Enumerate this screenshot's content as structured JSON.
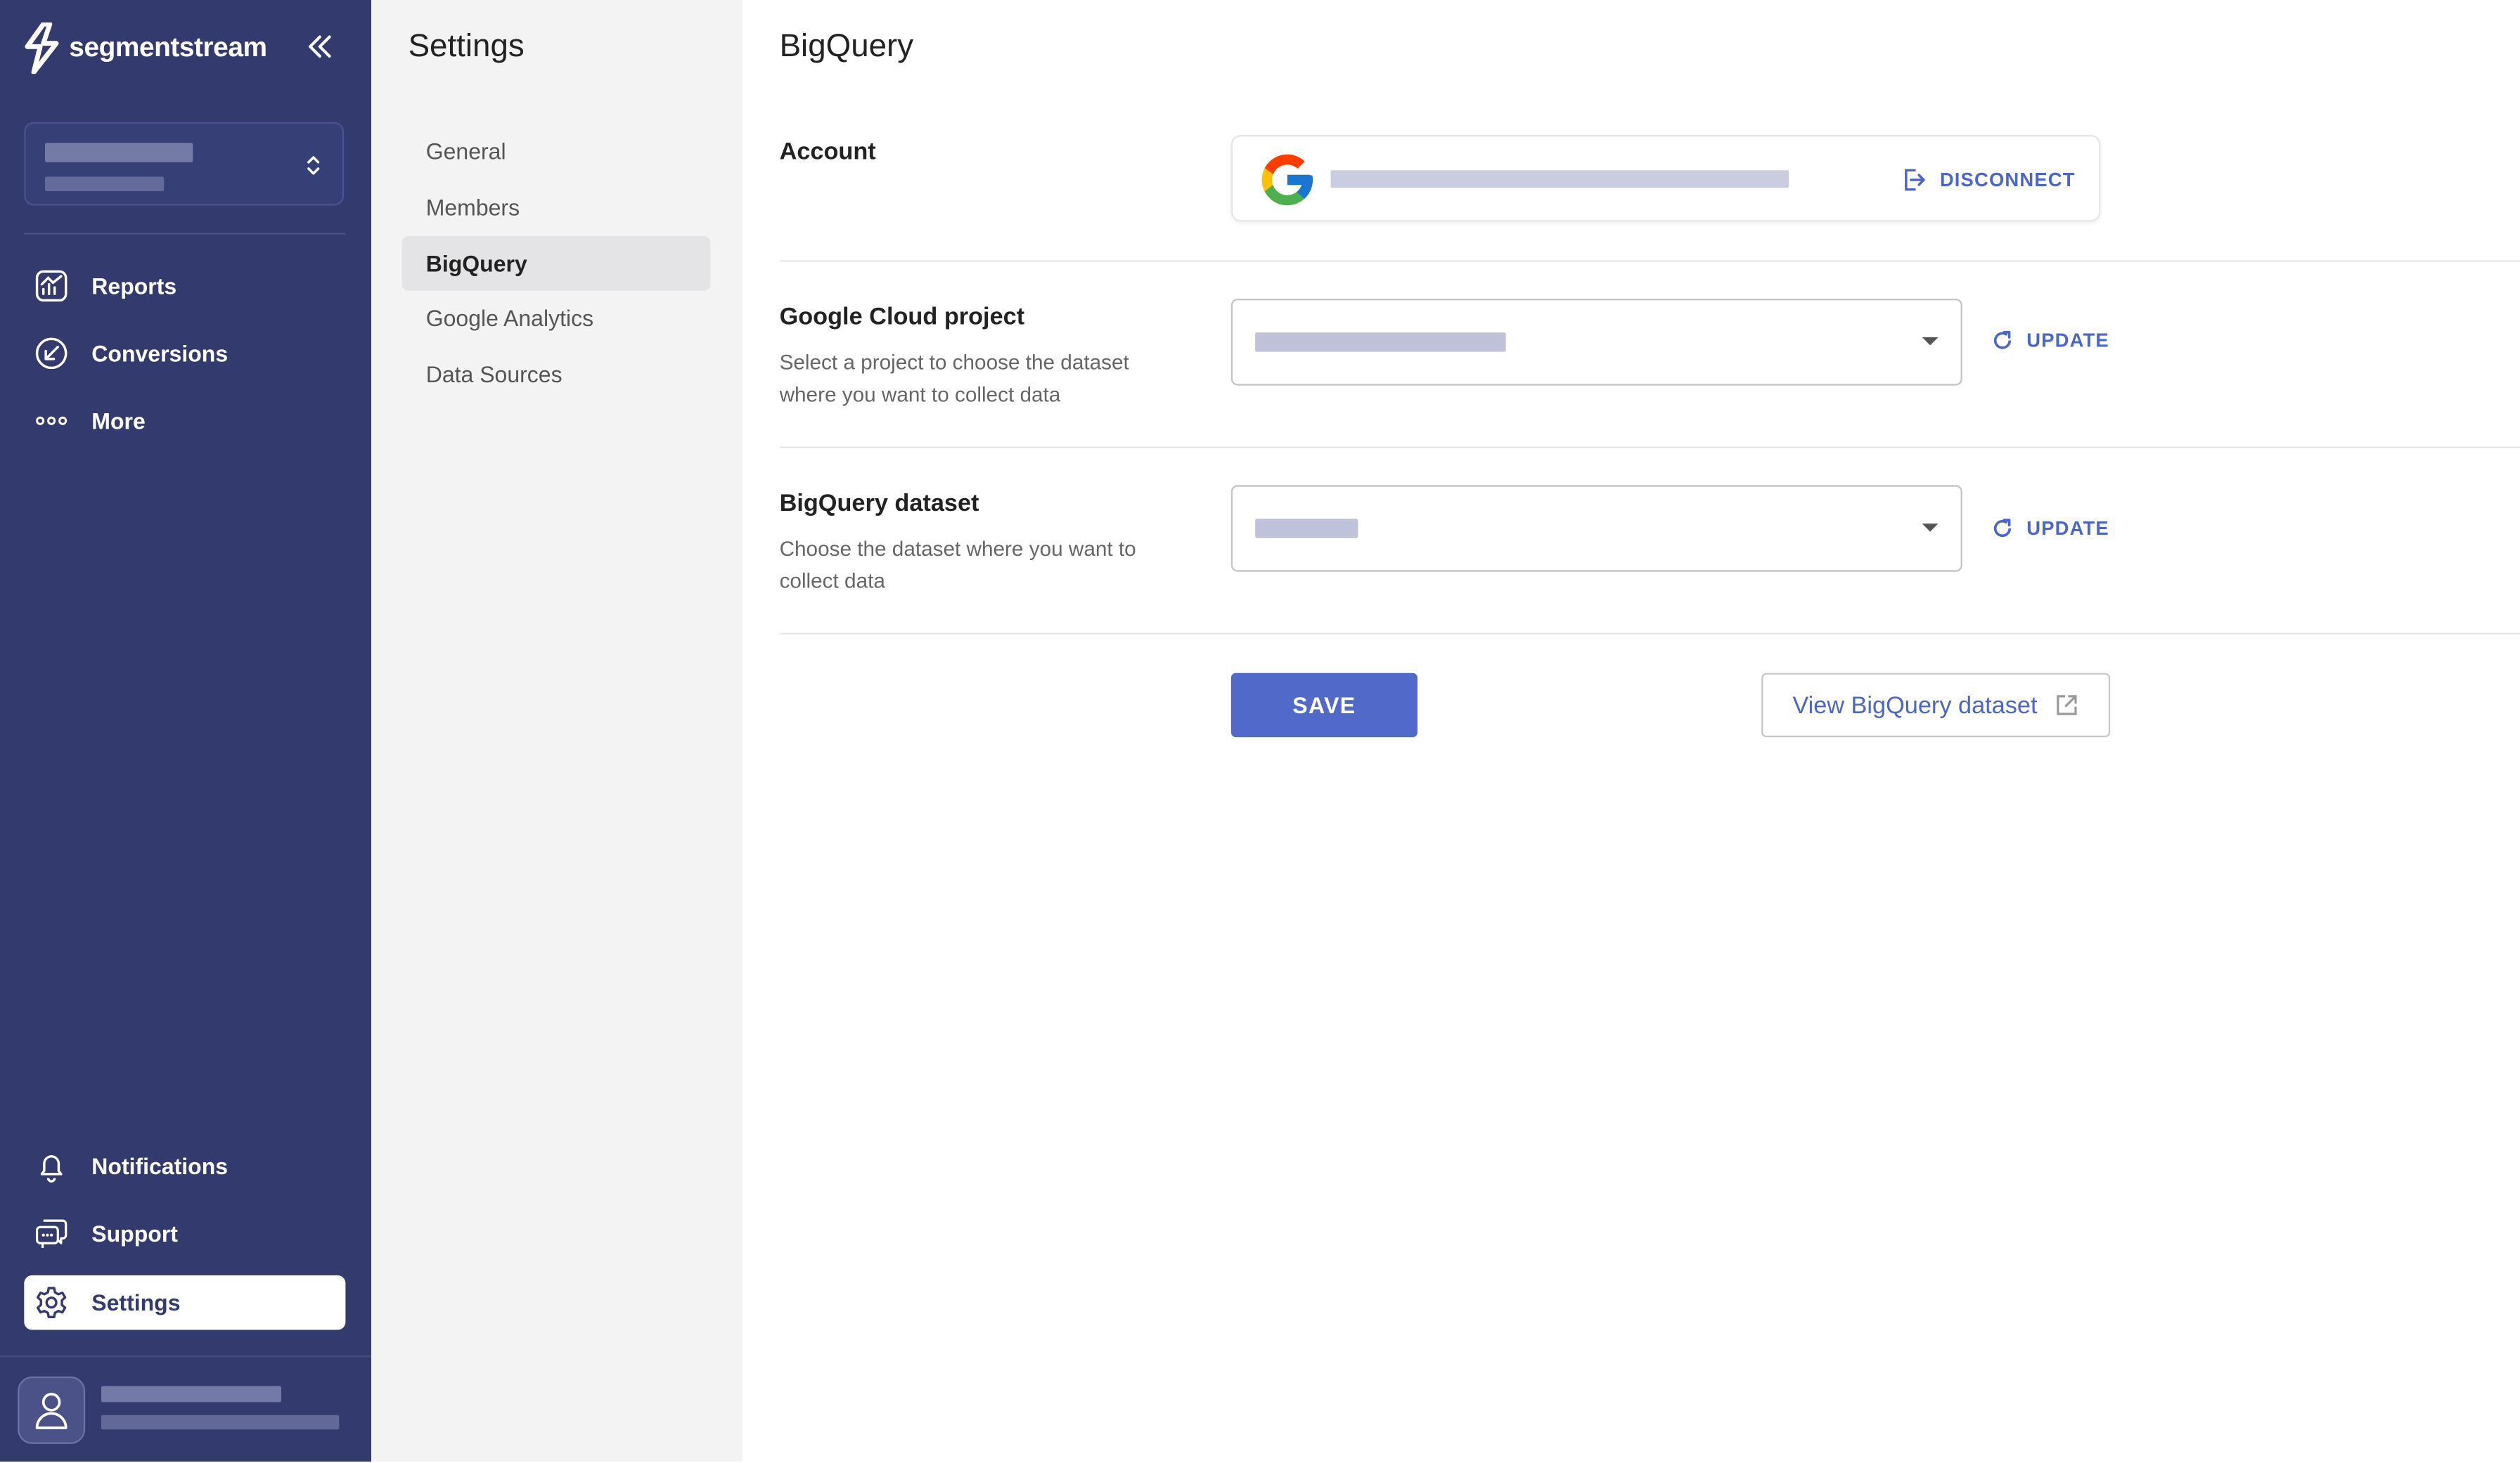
{
  "brand": {
    "name": "segmentstream"
  },
  "nav": {
    "items": [
      {
        "label": "Reports",
        "icon": "reports-icon"
      },
      {
        "label": "Conversions",
        "icon": "conversions-icon"
      },
      {
        "label": "More",
        "icon": "more-icon"
      }
    ],
    "bottom_items": [
      {
        "label": "Notifications",
        "icon": "bell-icon"
      },
      {
        "label": "Support",
        "icon": "chat-icon"
      },
      {
        "label": "Settings",
        "icon": "gear-icon",
        "active": true
      }
    ]
  },
  "settings": {
    "title": "Settings",
    "items": [
      {
        "label": "General"
      },
      {
        "label": "Members"
      },
      {
        "label": "BigQuery",
        "active": true
      },
      {
        "label": "Google Analytics"
      },
      {
        "label": "Data Sources"
      }
    ]
  },
  "main": {
    "title": "BigQuery",
    "account": {
      "label": "Account",
      "disconnect_label": "DISCONNECT"
    },
    "project": {
      "label": "Google Cloud project",
      "description": "Select a project to choose the dataset where you want to collect data",
      "update_label": "UPDATE"
    },
    "dataset": {
      "label": "BigQuery dataset",
      "description": "Choose the dataset where you want to collect data",
      "update_label": "UPDATE"
    },
    "save_label": "SAVE",
    "view_label": "View BigQuery dataset"
  },
  "colors": {
    "sidebar": "#333b6e",
    "accent": "#5169c8",
    "link": "#4a66c8",
    "submenu_bg": "#f3f3f4"
  }
}
